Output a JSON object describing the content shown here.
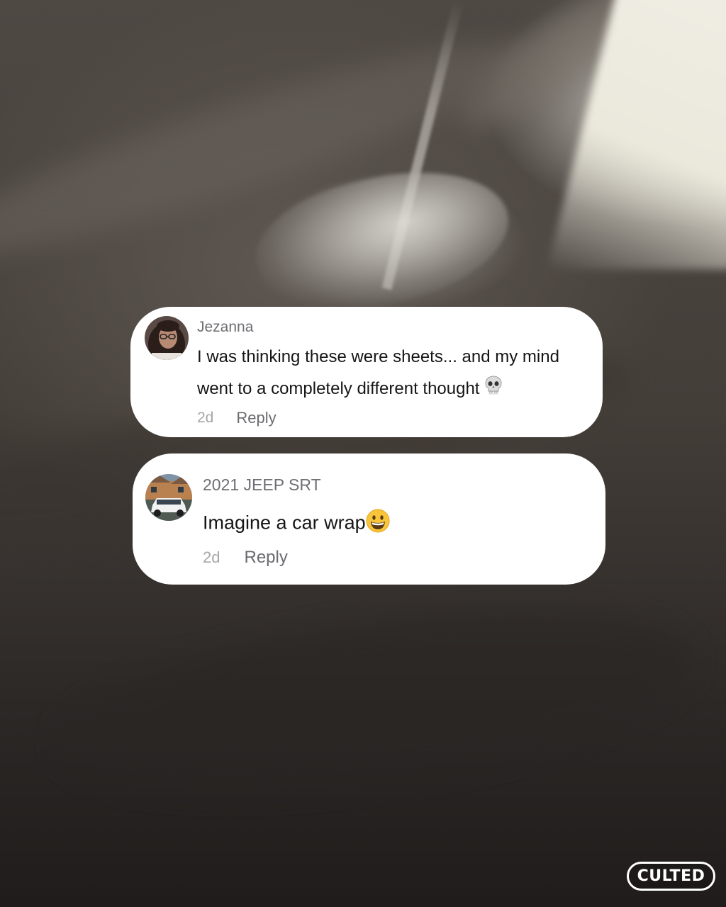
{
  "comments": [
    {
      "username": "Jezanna",
      "text_line1": "I was thinking these were sheets... and my mind",
      "text_line2": "went to a completely different thought",
      "emoji": "skull-emoji",
      "time": "2d",
      "reply_label": "Reply"
    },
    {
      "username": "2021 JEEP SRT",
      "text": "Imagine a car wrap",
      "emoji": "grinning-face-emoji",
      "time": "2d",
      "reply_label": "Reply"
    }
  ],
  "brand": {
    "logo_text": "CULTED"
  },
  "colors": {
    "card_background": "#ffffff",
    "username": "#6e6e73",
    "comment_text": "#161616",
    "time": "#a6a6aa",
    "reply": "#6a6a70"
  }
}
